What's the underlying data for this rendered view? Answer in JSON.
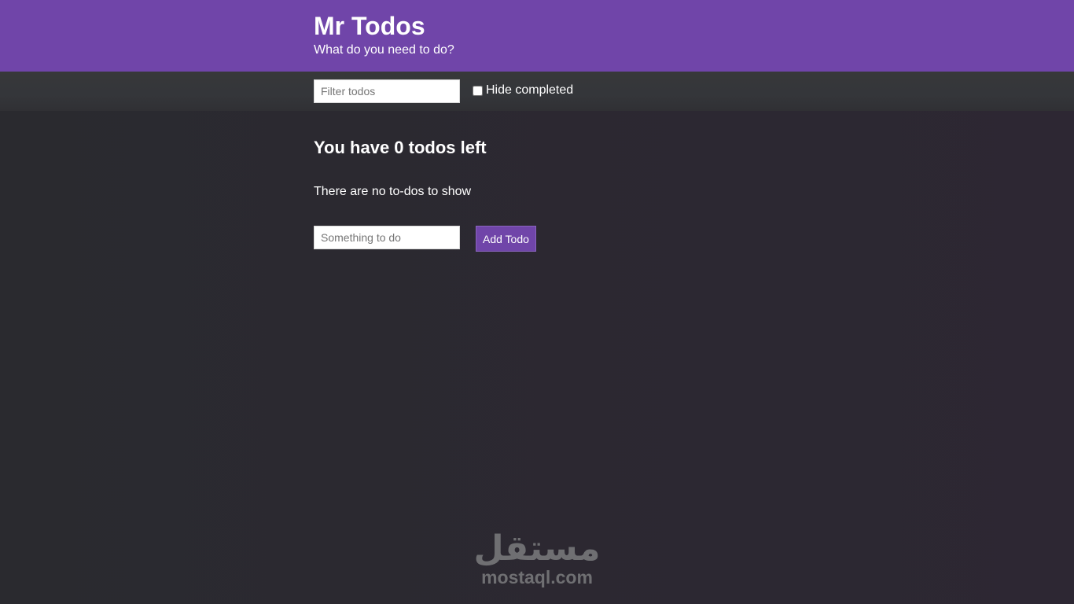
{
  "header": {
    "title": "Mr Todos",
    "subtitle": "What do you need to do?"
  },
  "filter": {
    "placeholder": "Filter todos",
    "value": "",
    "hide_completed_label": "Hide completed",
    "hide_completed_checked": false
  },
  "summary": {
    "todos_left_text": "You have 0 todos left",
    "empty_text": "There are no to-dos to show"
  },
  "add_todo": {
    "placeholder": "Something to do",
    "value": "",
    "button_label": "Add Todo"
  },
  "watermark": {
    "logo_text": "مستقل",
    "site_text": "mostaql.com"
  },
  "colors": {
    "accent": "#7045a9",
    "background": "#2a2a2f",
    "filter_bar": "#363739"
  }
}
